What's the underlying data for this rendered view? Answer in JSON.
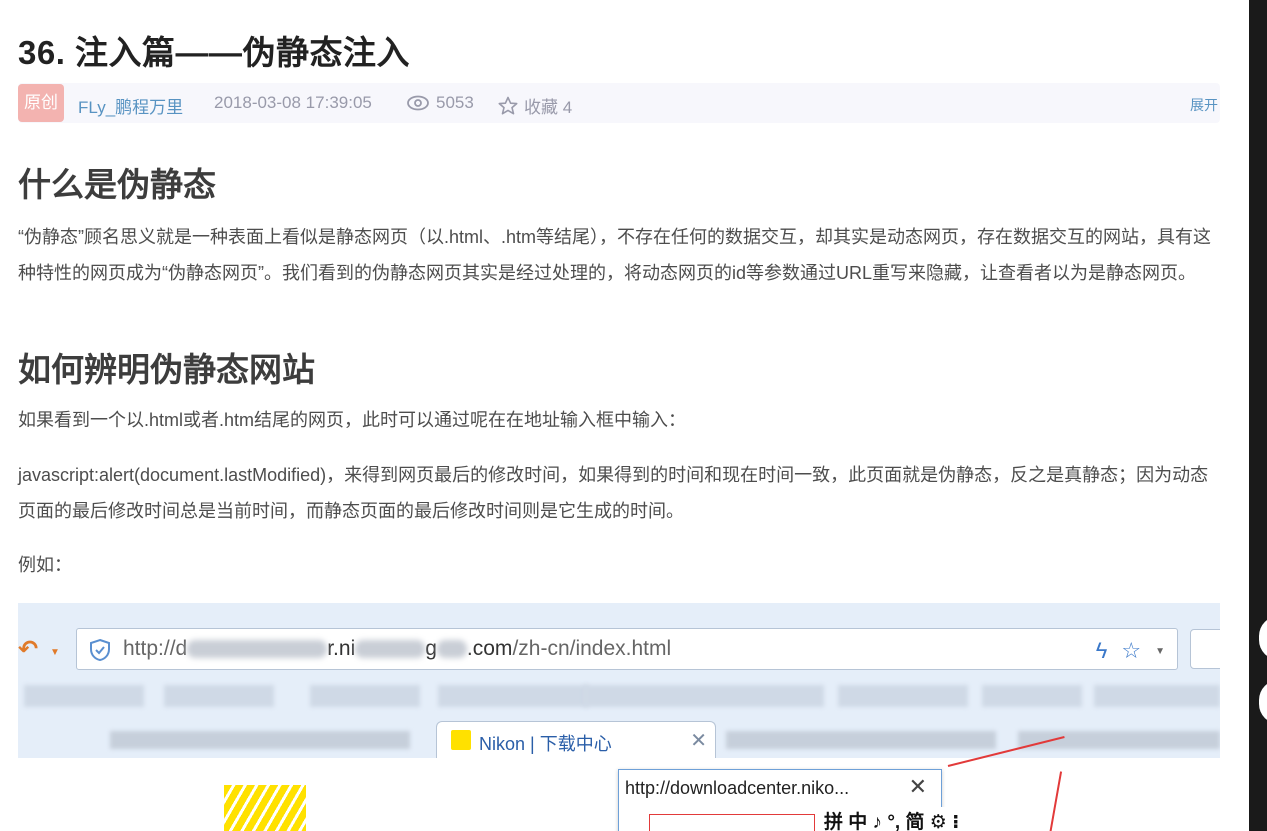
{
  "article": {
    "title": "36. 注入篇——伪静态注入",
    "meta": {
      "badge": "原创",
      "author": "FLy_鹏程万里",
      "date": "2018-03-08 17:39:05",
      "views": "5053",
      "favorites": "收藏 4",
      "expand": "展开"
    },
    "sections": [
      {
        "heading": "什么是伪静态",
        "paragraphs": [
          "“伪静态”顾名思义就是一种表面上看似是静态网页（以.html、.htm等结尾），不存在任何的数据交互，却其实是动态网页，存在数据交互的网站，具有这种特性的网页成为“伪静态网页”。我们看到的伪静态网页其实是经过处理的，将动态网页的id等参数通过URL重写来隐藏，让查看者以为是静态网页。"
        ]
      },
      {
        "heading": "如何辨明伪静态网站",
        "paragraphs": [
          "如果看到一个以.html或者.htm结尾的网页，此时可以通过呢在在地址输入框中输入：",
          "javascript:alert(document.lastModified)，来得到网页最后的修改时间，如果得到的时间和现在时间一致，此页面就是伪静态，反之是真静态；因为动态页面的最后修改时间总是当前时间，而静态页面的最后修改时间则是它生成的时间。",
          "例如："
        ]
      }
    ]
  },
  "screenshot": {
    "url_prefix": "http://d",
    "url_mid1": "r.ni",
    "url_mid2": "g",
    "url_domain": ".com",
    "url_path": "/zh-cn/index.html",
    "tab_title": "Nikon | 下载中心",
    "popup_url": "http://downloadcenter.niko...",
    "ime_bar": "拼 中 ♪ °, 简 ⚙ ⁝"
  },
  "icons": {
    "views": "eye-icon",
    "favorites": "star-outline-icon",
    "close": "close-icon",
    "shield": "shield-check-icon",
    "lightning": "lightning-icon",
    "bookmark": "star-icon"
  },
  "colors": {
    "badge_bg": "#f3b3b0",
    "author": "#5893c2",
    "meta_bg": "#f7f7fc",
    "heading": "#3d3d3d",
    "text": "#4d4d4d"
  }
}
